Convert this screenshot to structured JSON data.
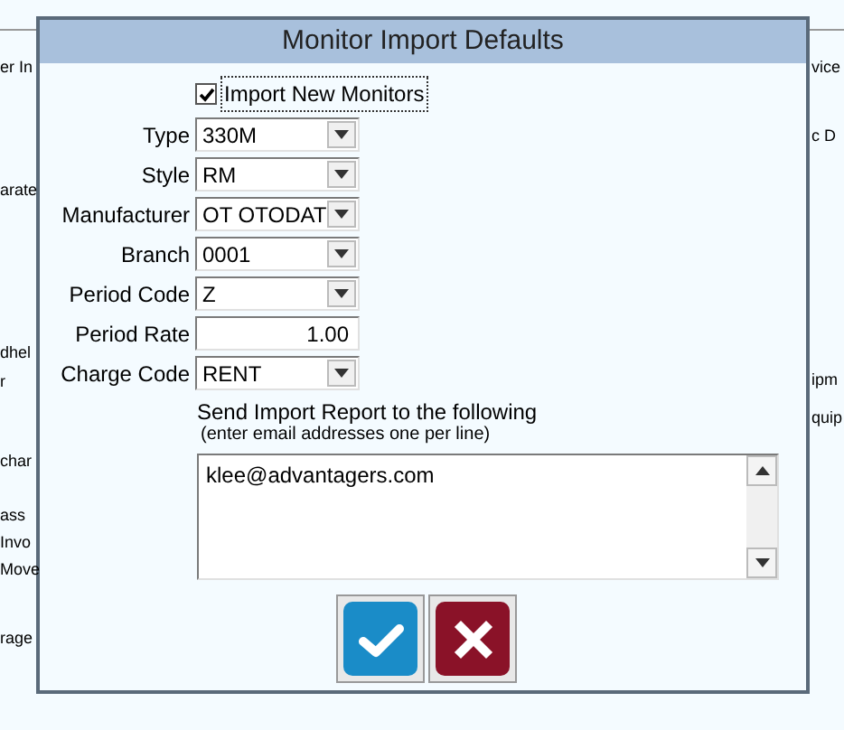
{
  "background": {
    "left_fragments": [
      "er In",
      "arate",
      "dhel",
      "r",
      "char",
      "ass",
      "Invo",
      "Move",
      "rage"
    ],
    "right_fragments": [
      "vice",
      "c D",
      "ipm",
      "quip"
    ]
  },
  "dialog": {
    "title": "Monitor Import Defaults",
    "import_checkbox": {
      "label": "Import New Monitors",
      "checked": true
    },
    "fields": [
      {
        "label": "Type",
        "value": "330M",
        "kind": "dropdown"
      },
      {
        "label": "Style",
        "value": "RM",
        "kind": "dropdown"
      },
      {
        "label": "Manufacturer",
        "value": "OT OTODAT",
        "kind": "dropdown"
      },
      {
        "label": "Branch",
        "value": "0001",
        "kind": "dropdown"
      },
      {
        "label": "Period Code",
        "value": "Z",
        "kind": "dropdown"
      },
      {
        "label": "Period Rate",
        "value": "1.00",
        "kind": "number"
      },
      {
        "label": "Charge Code",
        "value": "RENT",
        "kind": "dropdown"
      }
    ],
    "report_label": "Send Import Report to the following",
    "report_hint": "(enter email addresses one per line)",
    "emails": "klee@advantagers.com"
  }
}
